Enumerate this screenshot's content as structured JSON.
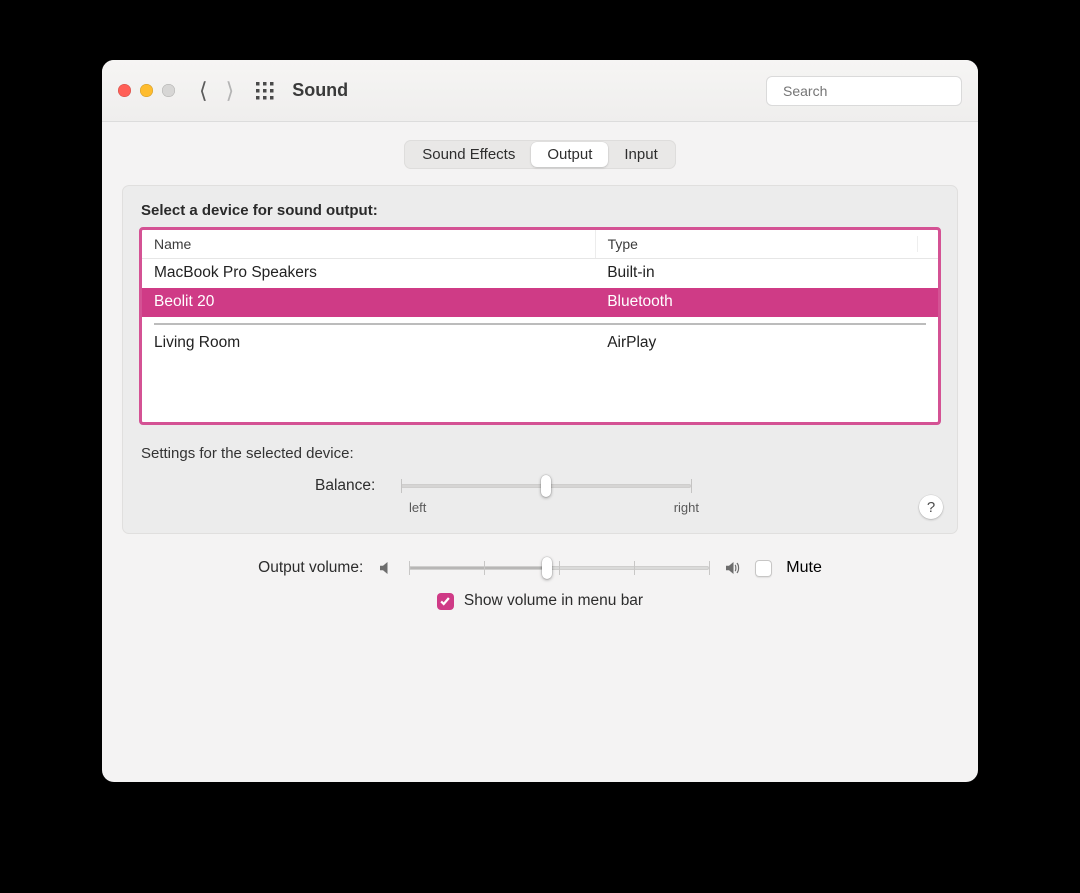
{
  "window": {
    "title": "Sound"
  },
  "search": {
    "placeholder": "Search"
  },
  "tabs": [
    {
      "label": "Sound Effects",
      "active": false
    },
    {
      "label": "Output",
      "active": true
    },
    {
      "label": "Input",
      "active": false
    }
  ],
  "panel": {
    "heading": "Select a device for sound output:",
    "columns": {
      "name": "Name",
      "type": "Type"
    },
    "devices": [
      {
        "name": "MacBook Pro Speakers",
        "type": "Built-in",
        "selected": false
      },
      {
        "name": "Beolit 20",
        "type": "Bluetooth",
        "selected": true
      },
      {
        "name": "Living Room",
        "type": "AirPlay",
        "selected": false
      }
    ],
    "settings_label": "Settings for the selected device:",
    "balance": {
      "label": "Balance:",
      "left": "left",
      "right": "right",
      "value": 50
    }
  },
  "footer": {
    "volume_label": "Output volume:",
    "volume_value": 46,
    "mute_label": "Mute",
    "mute_checked": false,
    "show_label": "Show volume in menu bar",
    "show_checked": true
  },
  "help": "?"
}
